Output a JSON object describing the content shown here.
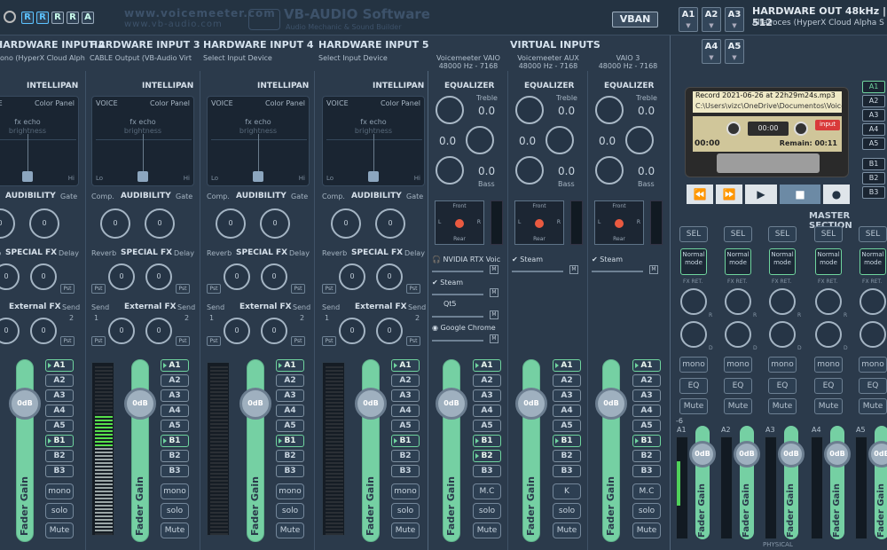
{
  "top": {
    "rec_buttons": [
      "R",
      "R",
      "R",
      "R",
      "A"
    ],
    "logo_main": "www.voicemeeter.com",
    "logo_sub": "www.vb-audio.com",
    "brand": "VB-AUDIO Software",
    "brand_sub": "Audio Mechanic & Sound Builder",
    "vban_label": "VBAN",
    "hw_out_buttons": [
      "A1",
      "A2",
      "A3",
      "A4",
      "A5"
    ],
    "hw_out_title": "HARDWARE OUT 48kHz | 512",
    "hw_out_device": "Altavoces (HyperX Cloud Alpha S Gaming)"
  },
  "hw_inputs": [
    {
      "title": "HARDWARE INPUT  2",
      "device": "ono (HyperX Cloud Alph"
    },
    {
      "title": "HARDWARE INPUT  3",
      "device": "CABLE Output (VB-Audio Virt"
    },
    {
      "title": "HARDWARE INPUT  4",
      "device": "Select Input Device"
    },
    {
      "title": "HARDWARE INPUT  5",
      "device": "Select Input Device"
    }
  ],
  "virtual": {
    "title": "VIRTUAL INPUTS",
    "strips": [
      {
        "name": "Voicemeeter VAIO",
        "rate": "48000 Hz - 7168"
      },
      {
        "name": "Voicemeeter AUX",
        "rate": "48000 Hz - 7168"
      },
      {
        "name": "VAIO 3",
        "rate": "48000 Hz - 7168"
      }
    ],
    "eq_label": "EQUALIZER",
    "treble": "Treble",
    "bass": "Bass",
    "eq_values": [
      "0.0",
      "0.0",
      "0.0"
    ],
    "front": "Front",
    "rear": "Rear",
    "lr_l": "L",
    "lr_r": "R",
    "apps_col1": [
      "NVIDIA RTX Voic",
      "Steam",
      "Qt5",
      "Google Chrome"
    ],
    "apps_col2": [
      "Steam"
    ],
    "apps_col3": [
      "Steam"
    ],
    "m_label": "M",
    "mc_labels": [
      "M.C",
      "K",
      "M.C"
    ]
  },
  "strip_labels": {
    "intellipan": "INTELLIPAN",
    "voice": "VOICE",
    "color_panel": "Color Panel",
    "fx_echo": "fx echo",
    "brightness": "brightness",
    "lo": "Lo",
    "hi": "Hi",
    "comp": "Comp.",
    "audibility": "AUDIBILITY",
    "gate": "Gate",
    "reverb": "Reverb",
    "special_fx": "SPECIAL FX",
    "delay": "Delay",
    "send": "Send",
    "external_fx": "External FX",
    "pst": "Pst",
    "knob_zero": "0",
    "one": "1",
    "two": "2",
    "fader_gain": "Fader Gain",
    "zero_db": "0dB",
    "bus_buttons": [
      "A1",
      "A2",
      "A3",
      "A4",
      "A5",
      "B1",
      "B2",
      "B3"
    ],
    "mono": "mono",
    "solo": "solo",
    "mute": "Mute"
  },
  "recorder": {
    "title": "Record 2021-06-26 at 22h29m24s.mp3",
    "path": "C:\\Users\\vizc\\OneDrive\\Documentos\\Voicemeeter",
    "time": "00:00",
    "counter": "00:00",
    "remain": "Remain: 00:11",
    "input": "input",
    "out_select": [
      "A1",
      "A2",
      "A3",
      "A4",
      "A5",
      "B1",
      "B2",
      "B3"
    ]
  },
  "master": {
    "title": "MASTER SECTION",
    "sel": "SEL",
    "normal_mode": "Normal mode",
    "fx_ret": "FX RET.",
    "r": "R",
    "d": "D",
    "mono": "mono",
    "eq": "EQ",
    "mute": "Mute",
    "buses": [
      "A1",
      "A2",
      "A3",
      "A4",
      "A5"
    ],
    "db_mark": "-6",
    "physical": "PHYSICAL"
  },
  "colors": {
    "fader": "#75d0a3",
    "accent": "#5cc3ff",
    "record_red": "#d93a3a"
  }
}
